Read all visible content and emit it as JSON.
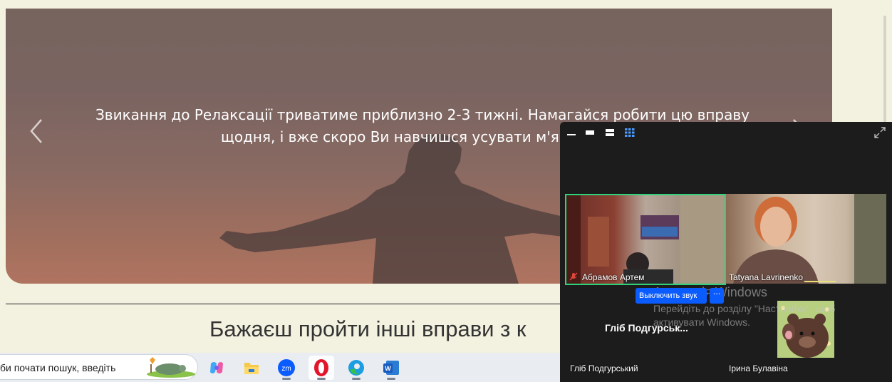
{
  "hero": {
    "text": "Звикання до Релаксації триватиме приблизно 2-3 тижні. Намагайся робити цю вправу щодня, і вже скоро Ви навчишся усувати м'язову нап",
    "prev_icon": "chevron-left-icon",
    "next_icon": "chevron-right-icon"
  },
  "section": {
    "heading": "Бажаєш пройти інші вправи з к"
  },
  "taskbar": {
    "search_text": "би почати пошук, введіть",
    "apps": [
      {
        "name": "copilot-icon"
      },
      {
        "name": "file-explorer-icon"
      },
      {
        "name": "zoom-icon",
        "label": "zm"
      },
      {
        "name": "opera-icon"
      },
      {
        "name": "edge-icon"
      },
      {
        "name": "word-icon",
        "label": "W"
      }
    ]
  },
  "zoom": {
    "toolbar_icons": [
      "minimize-icon",
      "speaker-view-icon",
      "split-view-icon",
      "gallery-view-icon",
      "expand-icon"
    ],
    "participants": [
      {
        "name": "Абрамов Артем",
        "muted": true,
        "active_speaker": true
      },
      {
        "name": "Tatyana Lavrinenko"
      },
      {
        "name": "Гліб Подгурський",
        "center_name": "Гліб  Подгурськ..."
      },
      {
        "name": "Ірина Булавіна"
      }
    ],
    "mute_button": "Выключить звук",
    "more_button": "···"
  },
  "watermark": {
    "title": "Активація Windows",
    "text": "Перейдіть до розділу \"Настройки\", щоб активувати Windows."
  },
  "colors": {
    "page_bg": "#f3f1df",
    "zoom_bg": "#1c1c1c",
    "zoom_blue": "#0b5cff",
    "active_speaker": "#2fd27b"
  }
}
